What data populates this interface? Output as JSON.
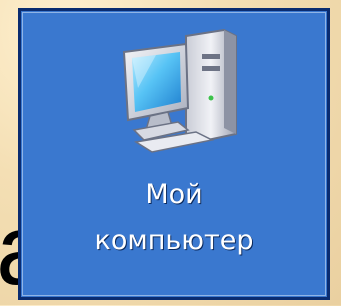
{
  "stray_text": "а",
  "desktop_icon": {
    "icon": "my-computer-icon",
    "label_line_1": "Мой",
    "label_line_2": "компьютер"
  },
  "colors": {
    "selection_background": "#3a78cf",
    "selection_border": "#0a2c70",
    "page_background": "#f4dfb4"
  }
}
